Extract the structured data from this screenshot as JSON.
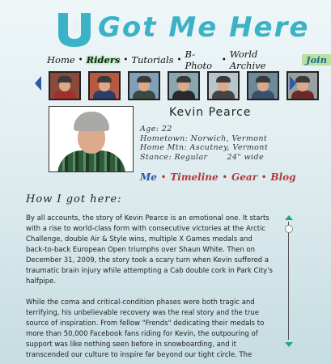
{
  "header": {
    "brand_text": "Got Me Here",
    "logo_icon": "u-turn-logo-icon",
    "brand_color": "#3ab3c6"
  },
  "nav": {
    "items": [
      "Home",
      "Riders",
      "Tutorials",
      "B-Photo",
      "World Archive"
    ],
    "active_index": 1,
    "join_label": "Join"
  },
  "carousel": {
    "prev_icon": "chevron-left-icon",
    "next_icon": "chevron-right-icon",
    "thumbs": [
      {
        "bg": "#8a4a3a",
        "body": "#a0302a"
      },
      {
        "bg": "#b55a40",
        "body": "#2a3e6a"
      },
      {
        "bg": "#7fa0b8",
        "body": "#374a40"
      },
      {
        "bg": "#8aa6b0",
        "body": "#2a2a2a"
      },
      {
        "bg": "#b6c6cc",
        "body": "#444"
      },
      {
        "bg": "#6c8a9a",
        "body": "#3a4f6a"
      },
      {
        "bg": "#9aa0a0",
        "body": "#6a2a2a"
      }
    ]
  },
  "profile": {
    "name": "Kevin Pearce",
    "facts": [
      {
        "label": "Age:",
        "value": "22"
      },
      {
        "label": "Hometown:",
        "value": "Norwich, Vermont"
      },
      {
        "label": "Home Mtn:",
        "value": "Ascutney, Vermont"
      },
      {
        "label": "Stance:",
        "value": "Regular       24\" wide"
      }
    ]
  },
  "subnav": {
    "me": "Me",
    "timeline": "Timeline",
    "gear": "Gear",
    "blog": "Blog"
  },
  "story": {
    "title": "How I got here:",
    "paragraphs": [
      "By all accounts, the story of Kevin Pearce is an emotional one. It starts with a rise to world-class form with consecutive victories at the Arctic Challenge, double Air & Style wins, multiple X Games medals and back-to-back European Open triumphs over Shaun White. Then on December 31, 2009, the story took a scary turn when Kevin suffered a traumatic brain injury while attempting a Cab double cork in Park City's halfpipe.",
      "While the coma and critical-condition phases were both tragic and terrifying, his unbelievable recovery was the real story and the true source of inspiration. From fellow \"Frends\" dedicating their medals to more than 50,000 Facebook fans riding for Kevin, the outpouring of support was like nothing seen before in snowboarding, and it transcended our culture to inspire far beyond our tight circle. The"
    ]
  },
  "scroll": {
    "up_icon": "scroll-up-arrow-icon",
    "down_icon": "scroll-down-arrow-icon"
  }
}
